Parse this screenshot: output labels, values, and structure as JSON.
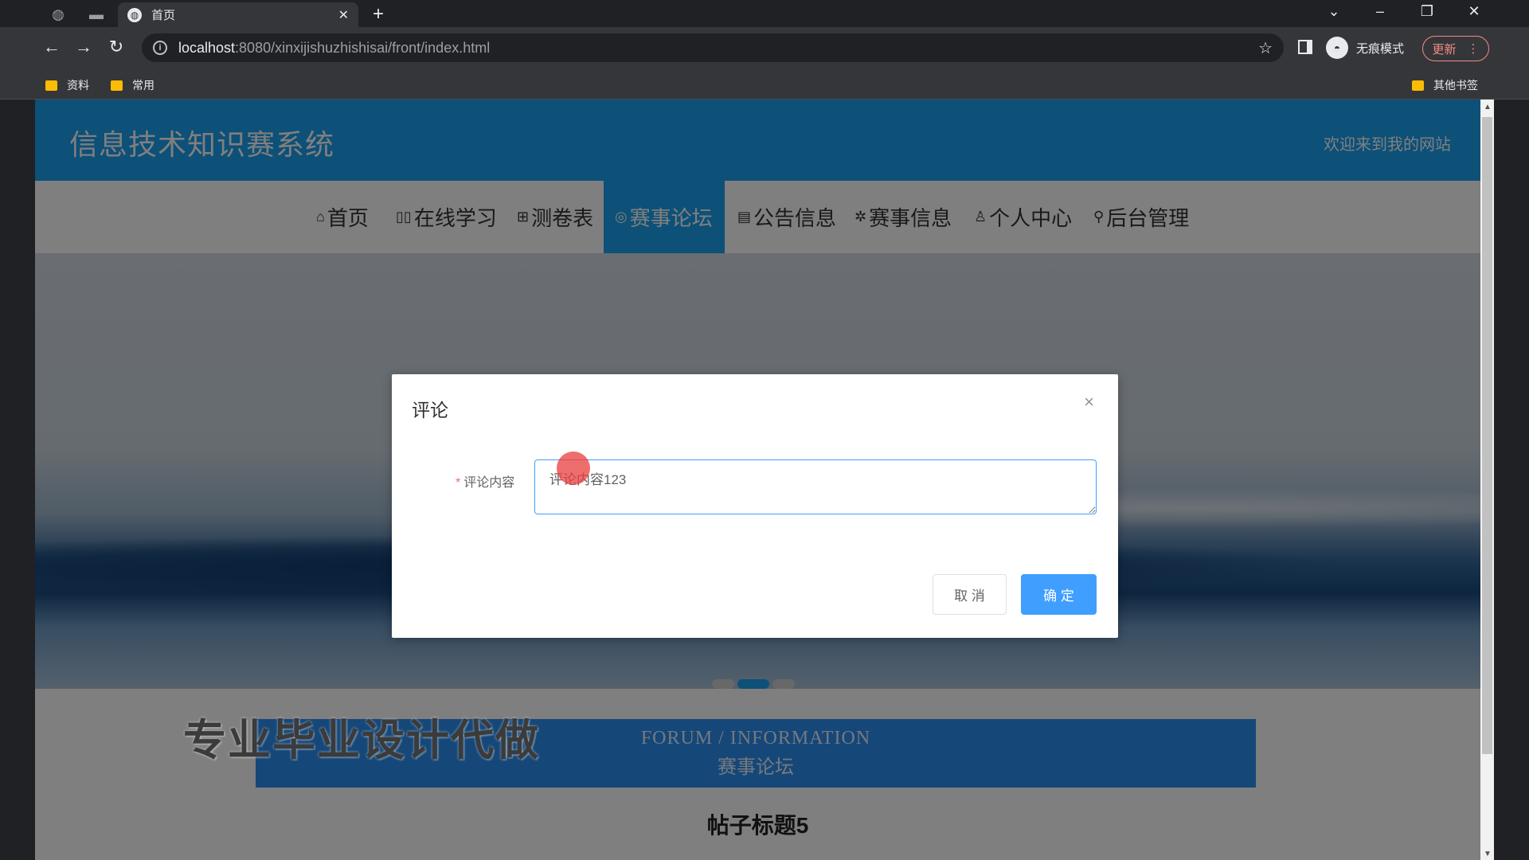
{
  "browser": {
    "tab_title": "首页",
    "tab_close": "✕",
    "new_tab": "+",
    "url_host": "localhost",
    "url_path": ":8080/xinxijishuzhishisai/front/index.html",
    "incognito_label": "无痕模式",
    "update_label": "更新",
    "bookmarks": [
      "资料",
      "常用"
    ],
    "other_bookmarks": "其他书签"
  },
  "site": {
    "title": "信息技术知识赛系统",
    "welcome": "欢迎来到我的网站",
    "nav": [
      {
        "icon": "⌂",
        "label": "首页"
      },
      {
        "icon": "▯▯",
        "label": "在线学习"
      },
      {
        "icon": "⊞",
        "label": "测卷表"
      },
      {
        "icon": "◎",
        "label": "赛事论坛"
      },
      {
        "icon": "▤",
        "label": "公告信息"
      },
      {
        "icon": "✲",
        "label": "赛事信息"
      },
      {
        "icon": "♙",
        "label": "个人中心"
      },
      {
        "icon": "⚲",
        "label": "后台管理"
      }
    ],
    "active_nav": "赛事论坛",
    "forum_en": "FORUM / INFORMATION",
    "forum_cn": "赛事论坛",
    "post_title": "帖子标题5"
  },
  "dialog": {
    "title": "评论",
    "close": "×",
    "required_mark": "*",
    "field_label": "评论内容",
    "field_value": "评论内容123",
    "cancel_label": "取 消",
    "confirm_label": "确 定"
  },
  "watermark": "专业毕业设计代做",
  "colors": {
    "accent": "#1aa0f0",
    "primary_button": "#409eff",
    "forum_band": "#2b8ef0"
  }
}
